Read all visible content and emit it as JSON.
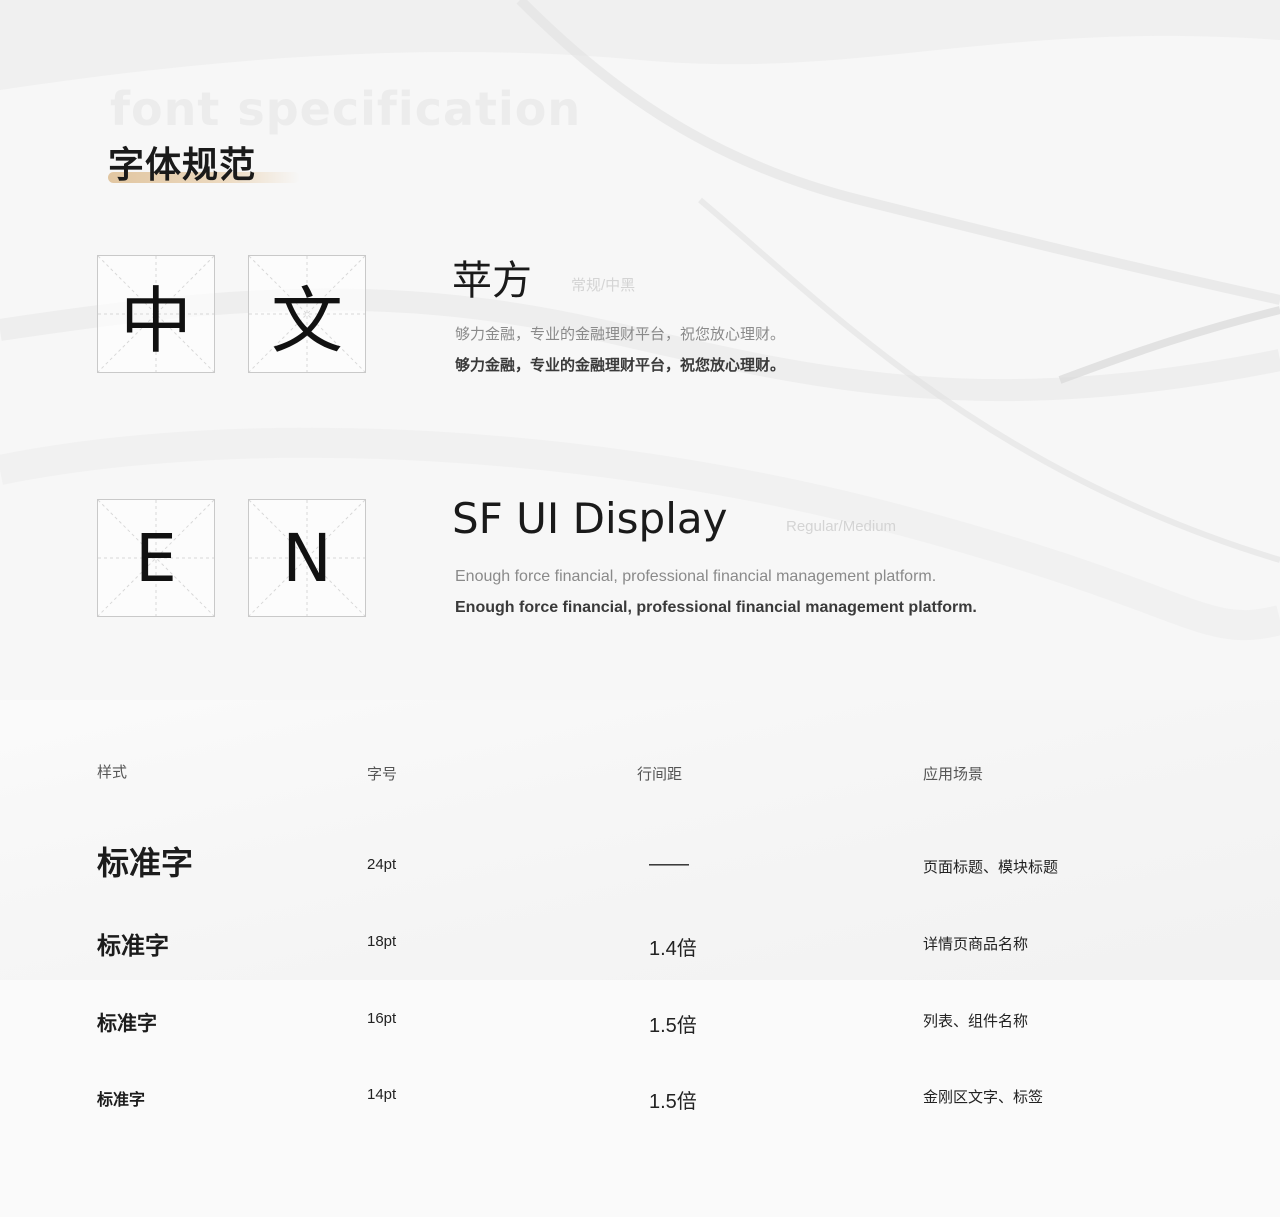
{
  "header": {
    "watermark": "font specification",
    "title": "字体规范"
  },
  "chinese_font": {
    "glyphs": [
      "中",
      "文"
    ],
    "name": "苹方",
    "weights": "常规/中黑",
    "sample_regular": "够力金融，专业的金融理财平台，祝您放心理财。",
    "sample_medium": "够力金融，专业的金融理财平台，祝您放心理财。"
  },
  "english_font": {
    "glyphs": [
      "E",
      "N"
    ],
    "name": "SF UI Display",
    "weights": "Regular/Medium",
    "sample_regular": "Enough force financial, professional financial management platform.",
    "sample_medium": "Enough force financial, professional financial management platform."
  },
  "table": {
    "headers": {
      "style": "样式",
      "size": "字号",
      "line_height": "行间距",
      "scene": "应用场景"
    },
    "rows": [
      {
        "style": "标准字",
        "size": "24pt",
        "line_height": "——",
        "scene": "页面标题、模块标题"
      },
      {
        "style": "标准字",
        "size": "18pt",
        "line_height": "1.4倍",
        "scene": "详情页商品名称"
      },
      {
        "style": "标准字",
        "size": "16pt",
        "line_height": "1.5倍",
        "scene": "列表、组件名称"
      },
      {
        "style": "标准字",
        "size": "14pt",
        "line_height": "1.5倍",
        "scene": "金刚区文字、标签"
      }
    ]
  },
  "colors": {
    "accent_underline": "#e1c6a1",
    "text_primary": "#1a1a1a",
    "text_secondary": "#8a8a8a",
    "text_faint": "#d4d4d4"
  }
}
